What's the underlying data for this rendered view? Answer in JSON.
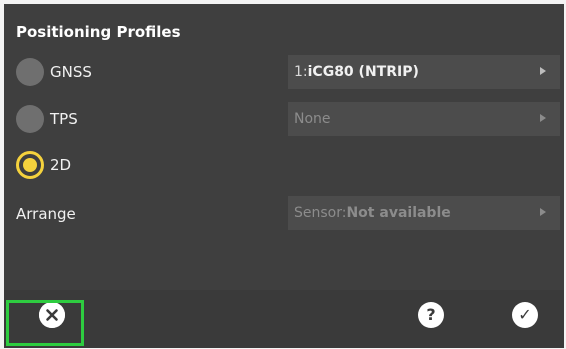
{
  "panel": {
    "title": "Positioning Profiles",
    "rows": [
      {
        "label": "GNSS",
        "selected": false,
        "select_prefix": "1:",
        "select_value": "iCG80 (NTRIP)"
      },
      {
        "label": "TPS",
        "selected": false,
        "select_value": "None"
      },
      {
        "label": "2D",
        "selected": true
      }
    ],
    "arrange": {
      "label": "Arrange",
      "select_prefix": "Sensor:",
      "select_value": "Not available"
    }
  },
  "toolbar": {
    "cancel_icon": "close-circle-icon",
    "help_icon": "question-circle-icon",
    "help_glyph": "?",
    "confirm_icon": "check-circle-icon",
    "confirm_glyph": "✓"
  },
  "colors": {
    "accent_selected": "#f5d23d",
    "highlight_border": "#2ecc40",
    "panel_bg": "#3f3f3f"
  }
}
